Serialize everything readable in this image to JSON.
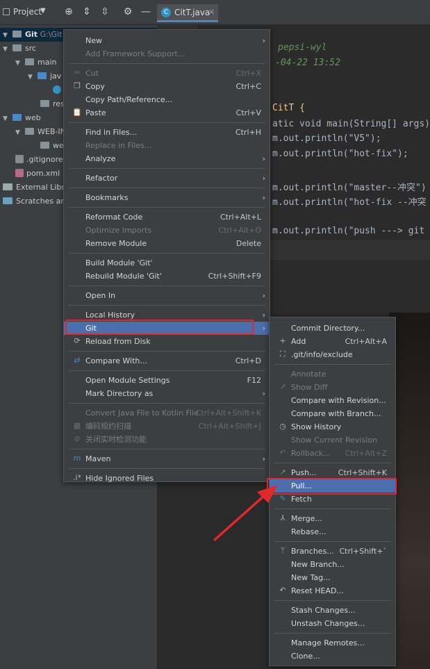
{
  "toolbar": {
    "project_label": "Project",
    "tab_label": "CitT.java"
  },
  "tree": {
    "items": [
      {
        "label": "Git",
        "sub": "G:\\Git"
      },
      {
        "label": "src"
      },
      {
        "label": "main"
      },
      {
        "label": "jav"
      },
      {
        "label": ""
      },
      {
        "label": "res"
      },
      {
        "label": "web"
      },
      {
        "label": "WEB-IN"
      },
      {
        "label": "we"
      },
      {
        "label": ".gitignore"
      },
      {
        "label": "pom.xml"
      },
      {
        "label": "External Libra"
      },
      {
        "label": "Scratches and"
      }
    ]
  },
  "editor": {
    "lines": [
      {
        "t": "pepsi-wyl"
      },
      {
        "t": "-04-22 13:52"
      },
      {
        "t": "CitT {"
      },
      {
        "t": "atic void main(String[] args)"
      },
      {
        "t": "m.out.println(\"V5\");"
      },
      {
        "t": "m.out.println(\"hot-fix\");"
      },
      {
        "t": "m.out.println(\"master--冲突\")"
      },
      {
        "t": "m.out.println(\"hot-fix --冲突"
      },
      {
        "t": "m.out.println(\"push ---> git"
      },
      {
        "t": "* /*"
      }
    ]
  },
  "context_menu": {
    "items": [
      {
        "label": "New",
        "shortcut": "",
        "submenu": true
      },
      {
        "label": "Add Framework Support...",
        "shortcut": "",
        "disabled": true
      },
      {
        "label": "Cut",
        "shortcut": "Ctrl+X",
        "disabled": true,
        "icon": "cut-icon"
      },
      {
        "label": "Copy",
        "shortcut": "Ctrl+C",
        "icon": "copy-icon"
      },
      {
        "label": "Copy Path/Reference...",
        "shortcut": ""
      },
      {
        "label": "Paste",
        "shortcut": "Ctrl+V",
        "icon": "paste-icon"
      },
      {
        "label": "Find in Files...",
        "shortcut": "Ctrl+H"
      },
      {
        "label": "Replace in Files...",
        "shortcut": "",
        "disabled": true
      },
      {
        "label": "Analyze",
        "shortcut": "",
        "submenu": true
      },
      {
        "label": "Refactor",
        "shortcut": "",
        "submenu": true
      },
      {
        "label": "Bookmarks",
        "shortcut": "",
        "submenu": true
      },
      {
        "label": "Reformat Code",
        "shortcut": "Ctrl+Alt+L"
      },
      {
        "label": "Optimize Imports",
        "shortcut": "Ctrl+Alt+O",
        "disabled": true
      },
      {
        "label": "Remove Module",
        "shortcut": "Delete"
      },
      {
        "label": "Build Module 'Git'",
        "shortcut": ""
      },
      {
        "label": "Rebuild Module 'Git'",
        "shortcut": "Ctrl+Shift+F9"
      },
      {
        "label": "Open In",
        "shortcut": "",
        "submenu": true
      },
      {
        "label": "Local History",
        "shortcut": "",
        "submenu": true
      },
      {
        "label": "Git",
        "shortcut": "",
        "submenu": true,
        "selected": true
      },
      {
        "label": "Reload from Disk",
        "shortcut": "",
        "icon": "reload-icon"
      },
      {
        "label": "Compare With...",
        "shortcut": "Ctrl+D",
        "icon": "compare-icon"
      },
      {
        "label": "Open Module Settings",
        "shortcut": "F12"
      },
      {
        "label": "Mark Directory as",
        "shortcut": "",
        "submenu": true
      },
      {
        "label": "Convert Java File to Kotlin File",
        "shortcut": "Ctrl+Alt+Shift+K",
        "disabled": true
      },
      {
        "label": "编码规约扫描",
        "shortcut": "Ctrl+Alt+Shift+J",
        "disabled": true,
        "icon": "scan-icon"
      },
      {
        "label": "关闭实时检测功能",
        "shortcut": "",
        "disabled": true,
        "icon": "disable-icon"
      },
      {
        "label": "Maven",
        "shortcut": "",
        "submenu": true,
        "icon": "maven-icon"
      },
      {
        "label": "Hide Ignored Files",
        "shortcut": "",
        "icon": "ignore-icon"
      }
    ]
  },
  "git_submenu": {
    "items": [
      {
        "label": "Commit Directory...",
        "shortcut": ""
      },
      {
        "label": "Add",
        "shortcut": "Ctrl+Alt+A",
        "icon": "add-icon"
      },
      {
        "label": ".git/info/exclude",
        "shortcut": "",
        "icon": "exclude-icon"
      },
      {
        "label": "Annotate",
        "shortcut": "",
        "disabled": true
      },
      {
        "label": "Show Diff",
        "shortcut": "",
        "disabled": true,
        "icon": "diff-icon"
      },
      {
        "label": "Compare with Revision...",
        "shortcut": ""
      },
      {
        "label": "Compare with Branch...",
        "shortcut": ""
      },
      {
        "label": "Show History",
        "shortcut": "",
        "icon": "history-icon"
      },
      {
        "label": "Show Current Revision",
        "shortcut": "",
        "disabled": true
      },
      {
        "label": "Rollback...",
        "shortcut": "Ctrl+Alt+Z",
        "disabled": true,
        "icon": "rollback-icon"
      },
      {
        "label": "Push...",
        "shortcut": "Ctrl+Shift+K",
        "icon": "push-icon"
      },
      {
        "label": "Pull...",
        "shortcut": "",
        "selected": true
      },
      {
        "label": "Fetch",
        "shortcut": "",
        "icon": "fetch-icon"
      },
      {
        "label": "Merge...",
        "shortcut": "",
        "icon": "merge-icon"
      },
      {
        "label": "Rebase...",
        "shortcut": ""
      },
      {
        "label": "Branches...",
        "shortcut": "Ctrl+Shift+`",
        "icon": "branch-icon"
      },
      {
        "label": "New Branch...",
        "shortcut": ""
      },
      {
        "label": "New Tag...",
        "shortcut": ""
      },
      {
        "label": "Reset HEAD...",
        "shortcut": "",
        "icon": "reset-icon"
      },
      {
        "label": "Stash Changes...",
        "shortcut": ""
      },
      {
        "label": "Unstash Changes...",
        "shortcut": ""
      },
      {
        "label": "Manage Remotes...",
        "shortcut": ""
      },
      {
        "label": "Clone...",
        "shortcut": ""
      }
    ]
  },
  "colors": {
    "selection": "#4b6eaf",
    "highlight": "#e02a2a",
    "menu_bg": "#3c3f41"
  }
}
